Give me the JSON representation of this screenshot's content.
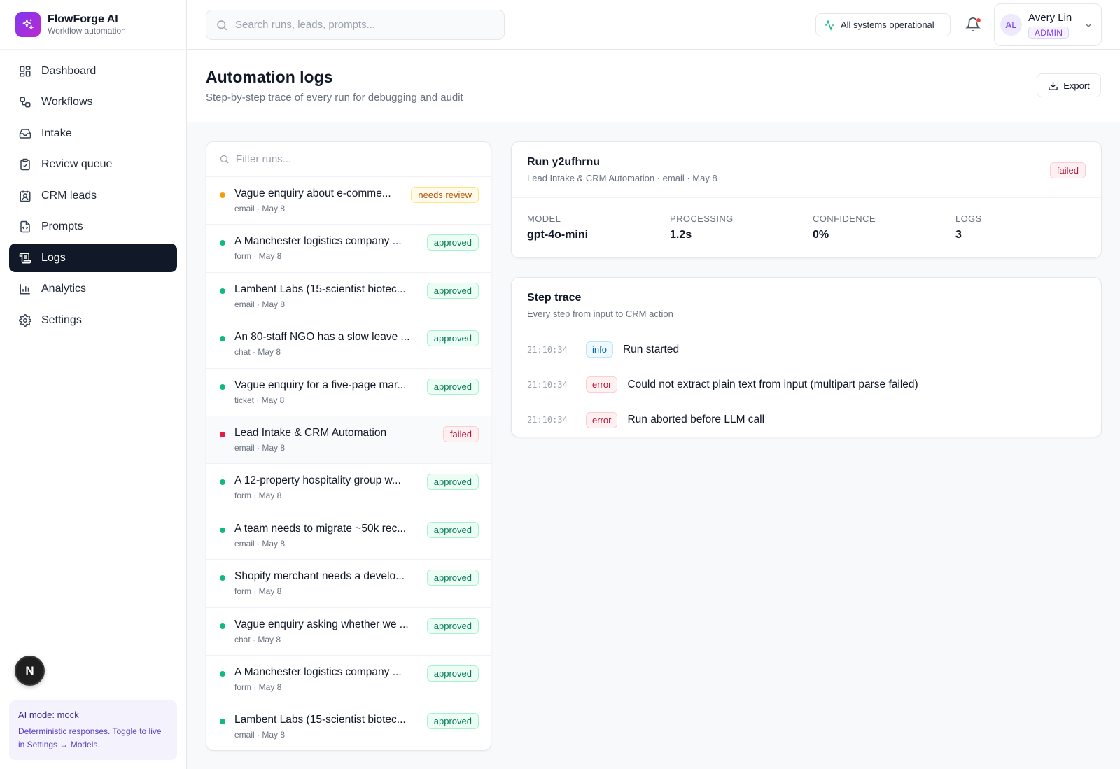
{
  "brand": {
    "name": "FlowForge AI",
    "subtitle": "Workflow automation",
    "accent": "#7c3aed"
  },
  "sidebar": {
    "items": [
      {
        "label": "Dashboard",
        "icon": "dashboard-icon"
      },
      {
        "label": "Workflows",
        "icon": "workflow-icon"
      },
      {
        "label": "Intake",
        "icon": "inbox-icon"
      },
      {
        "label": "Review queue",
        "icon": "clipboard-check-icon"
      },
      {
        "label": "CRM leads",
        "icon": "contact-icon"
      },
      {
        "label": "Prompts",
        "icon": "file-code-icon"
      },
      {
        "label": "Logs",
        "icon": "scroll-icon",
        "active": true
      },
      {
        "label": "Analytics",
        "icon": "bar-chart-icon"
      },
      {
        "label": "Settings",
        "icon": "gear-icon"
      }
    ],
    "floating_badge": "N",
    "ai_mode": {
      "title": "AI mode: mock",
      "description": "Deterministic responses. Toggle to live in Settings → Models."
    }
  },
  "topbar": {
    "search_placeholder": "Search runs, leads, prompts...",
    "status": "All systems operational",
    "user": {
      "initials": "AL",
      "name": "Avery Lin",
      "role": "ADMIN"
    }
  },
  "page": {
    "title": "Automation logs",
    "subtitle": "Step-by-step trace of every run for debugging and audit",
    "export_label": "Export"
  },
  "runs": {
    "filter_placeholder": "Filter runs...",
    "items": [
      {
        "title": "Vague enquiry about e-comme...",
        "meta": "email · May 8",
        "status": "needs review",
        "kind": "review"
      },
      {
        "title": "A Manchester logistics company ...",
        "meta": "form · May 8",
        "status": "approved",
        "kind": "approved"
      },
      {
        "title": "Lambent Labs (15-scientist biotec...",
        "meta": "email · May 8",
        "status": "approved",
        "kind": "approved"
      },
      {
        "title": "An 80-staff NGO has a slow leave ...",
        "meta": "chat · May 8",
        "status": "approved",
        "kind": "approved"
      },
      {
        "title": "Vague enquiry for a five-page mar...",
        "meta": "ticket · May 8",
        "status": "approved",
        "kind": "approved"
      },
      {
        "title": "Lead Intake & CRM Automation",
        "meta": "email · May 8",
        "status": "failed",
        "kind": "failed",
        "selected": true
      },
      {
        "title": "A 12-property hospitality group w...",
        "meta": "form · May 8",
        "status": "approved",
        "kind": "approved"
      },
      {
        "title": "A team needs to migrate ~50k rec...",
        "meta": "email · May 8",
        "status": "approved",
        "kind": "approved"
      },
      {
        "title": "Shopify merchant needs a develo...",
        "meta": "form · May 8",
        "status": "approved",
        "kind": "approved"
      },
      {
        "title": "Vague enquiry asking whether we ...",
        "meta": "chat · May 8",
        "status": "approved",
        "kind": "approved"
      },
      {
        "title": "A Manchester logistics company ...",
        "meta": "form · May 8",
        "status": "approved",
        "kind": "approved"
      },
      {
        "title": "Lambent Labs (15-scientist biotec...",
        "meta": "email · May 8",
        "status": "approved",
        "kind": "approved"
      }
    ],
    "dot_colors": {
      "approved": "#10b981",
      "review": "#f59e0b",
      "failed": "#e11d48"
    }
  },
  "detail": {
    "title": "Run y2ufhrnu",
    "subtitle": "Lead Intake & CRM Automation · email · May 8",
    "status": "failed",
    "stats": [
      {
        "label": "MODEL",
        "value": "gpt-4o-mini"
      },
      {
        "label": "PROCESSING",
        "value": "1.2s"
      },
      {
        "label": "CONFIDENCE",
        "value": "0%"
      },
      {
        "label": "LOGS",
        "value": "3"
      }
    ]
  },
  "trace": {
    "title": "Step trace",
    "subtitle": "Every step from input to CRM action",
    "steps": [
      {
        "time": "21:10:34",
        "level": "info",
        "message": "Run started"
      },
      {
        "time": "21:10:34",
        "level": "error",
        "message": "Could not extract plain text from input (multipart parse failed)"
      },
      {
        "time": "21:10:34",
        "level": "error",
        "message": "Run aborted before LLM call"
      }
    ]
  }
}
